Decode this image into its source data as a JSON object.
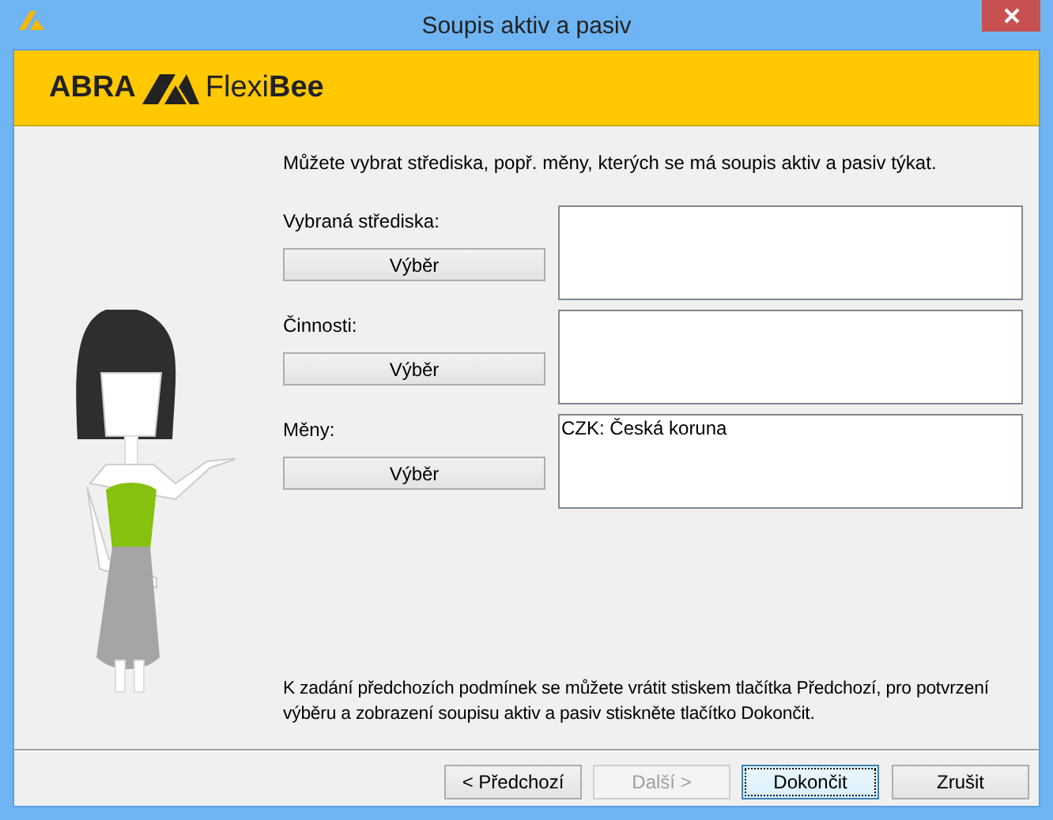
{
  "window": {
    "title": "Soupis aktiv a pasiv"
  },
  "header": {
    "brand": "ABRA",
    "product": "Flexi**Bee**"
  },
  "intro": "Můžete vybrat střediska, popř. měny, kterých se má soupis aktiv a pasiv týkat.",
  "groups": [
    {
      "label": "Vybraná střediska:",
      "button": "Výběr"
    },
    {
      "label": "Činnosti:",
      "button": "Výběr"
    },
    {
      "label": "Měny:",
      "button": "Výběr",
      "entries": [
        "CZK: Česká koruna"
      ]
    }
  ],
  "note": "K zadání předchozích podmínek se můžete vrátit stiskem tlačítka Předchozí, pro potvrzení výběru a zobrazení soupisu aktiv a pasiv stiskněte tlačítko Dokončit.",
  "buttons": [
    {
      "label": "< Předchozí",
      "disabled": false,
      "default": false
    },
    {
      "label": "Další >",
      "disabled": true,
      "default": false
    },
    {
      "label": "Dokončit",
      "disabled": false,
      "default": true
    },
    {
      "label": "Zrušit",
      "disabled": false,
      "default": false
    }
  ]
}
